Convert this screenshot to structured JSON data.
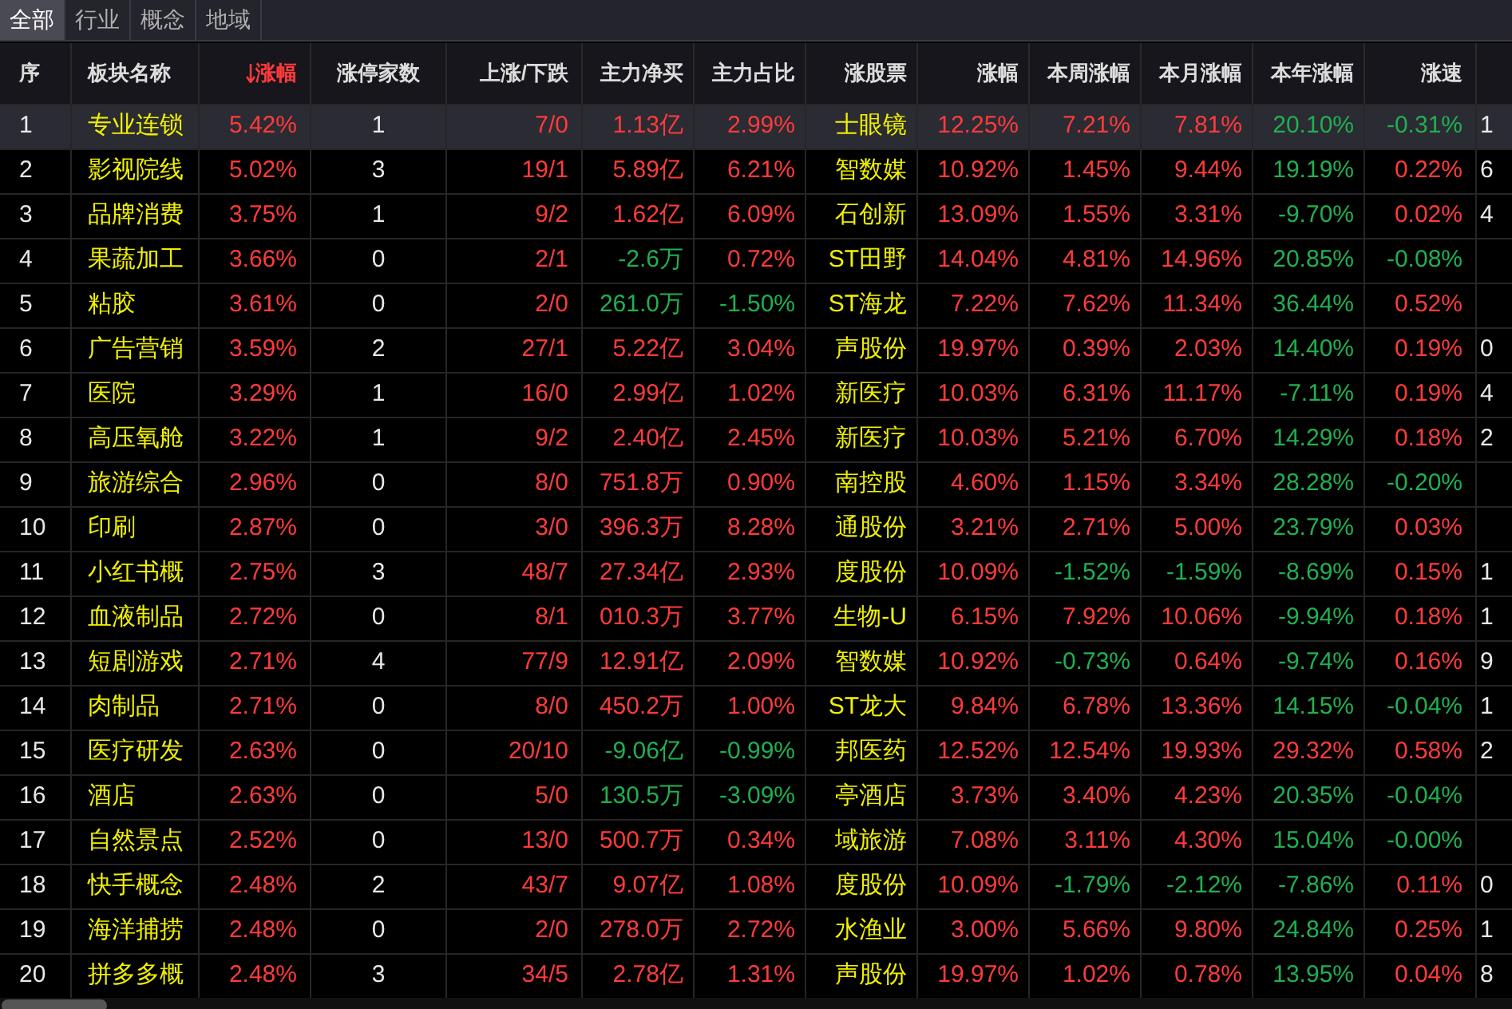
{
  "tabs": [
    {
      "label": "全部",
      "selected": true
    },
    {
      "label": "行业",
      "selected": false
    },
    {
      "label": "概念",
      "selected": false
    },
    {
      "label": "地域",
      "selected": false
    }
  ],
  "table": {
    "columns": [
      {
        "label": "序"
      },
      {
        "label": "板块名称"
      },
      {
        "label": "涨幅",
        "sorted_desc": true
      },
      {
        "label": "涨停家数"
      },
      {
        "label": "上涨/下跌"
      },
      {
        "label": "主力净买"
      },
      {
        "label": "主力占比"
      },
      {
        "label": "涨股票"
      },
      {
        "label": "涨幅"
      },
      {
        "label": "本周涨幅"
      },
      {
        "label": "本月涨幅"
      },
      {
        "label": "本年涨幅"
      },
      {
        "label": "涨速"
      }
    ],
    "rows": [
      {
        "selected": true,
        "cells": [
          "1",
          "专业连锁",
          {
            "text": "5.42%",
            "color": "#ff3b3b"
          },
          "1",
          {
            "text": "7/0",
            "color": "#ff3b3b"
          },
          {
            "text": "1.13亿",
            "color": "#ff3b3b"
          },
          {
            "text": "2.99%",
            "color": "#ff3b3b"
          },
          "士眼镜",
          {
            "text": "12.25%",
            "color": "#ff3b3b"
          },
          {
            "text": "7.21%",
            "color": "#ff3b3b"
          },
          {
            "text": "7.81%",
            "color": "#ff3b3b"
          },
          {
            "text": "20.10%",
            "color": "#20b050"
          },
          {
            "text": "-0.31%",
            "color": "#20b050"
          }
        ],
        "column_14": "1"
      },
      {
        "selected": false,
        "cells": [
          "2",
          "影视院线",
          {
            "text": "5.02%",
            "color": "#ff3b3b"
          },
          "3",
          {
            "text": "19/1",
            "color": "#ff3b3b"
          },
          {
            "text": "5.89亿",
            "color": "#ff3b3b"
          },
          {
            "text": "6.21%",
            "color": "#ff3b3b"
          },
          "智数媒",
          {
            "text": "10.92%",
            "color": "#ff3b3b"
          },
          {
            "text": "1.45%",
            "color": "#ff3b3b"
          },
          {
            "text": "9.44%",
            "color": "#ff3b3b"
          },
          {
            "text": "19.19%",
            "color": "#20b050"
          },
          {
            "text": "0.22%",
            "color": "#ff3b3b"
          }
        ],
        "column_14": "6"
      },
      {
        "selected": false,
        "cells": [
          "3",
          "品牌消费",
          {
            "text": "3.75%",
            "color": "#ff3b3b"
          },
          "1",
          {
            "text": "9/2",
            "color": "#ff3b3b"
          },
          {
            "text": "1.62亿",
            "color": "#ff3b3b"
          },
          {
            "text": "6.09%",
            "color": "#ff3b3b"
          },
          "石创新",
          {
            "text": "13.09%",
            "color": "#ff3b3b"
          },
          {
            "text": "1.55%",
            "color": "#ff3b3b"
          },
          {
            "text": "3.31%",
            "color": "#ff3b3b"
          },
          {
            "text": "-9.70%",
            "color": "#20b050"
          },
          {
            "text": "0.02%",
            "color": "#ff3b3b"
          }
        ],
        "column_14": "4"
      },
      {
        "selected": false,
        "cells": [
          "4",
          "果蔬加工",
          {
            "text": "3.66%",
            "color": "#ff3b3b"
          },
          "0",
          {
            "text": "2/1",
            "color": "#ff3b3b"
          },
          {
            "text": "-2.6万",
            "color": "#20b050"
          },
          {
            "text": "0.72%",
            "color": "#ff3b3b"
          },
          "ST田野",
          {
            "text": "14.04%",
            "color": "#ff3b3b"
          },
          {
            "text": "4.81%",
            "color": "#ff3b3b"
          },
          {
            "text": "14.96%",
            "color": "#ff3b3b"
          },
          {
            "text": "20.85%",
            "color": "#20b050"
          },
          {
            "text": "-0.08%",
            "color": "#20b050"
          }
        ]
      },
      {
        "selected": false,
        "cells": [
          "5",
          "粘胶",
          {
            "text": "3.61%",
            "color": "#ff3b3b"
          },
          "0",
          {
            "text": "2/0",
            "color": "#ff3b3b"
          },
          {
            "text": "261.0万",
            "color": "#20b050"
          },
          {
            "text": "-1.50%",
            "color": "#20b050"
          },
          "ST海龙",
          {
            "text": "7.22%",
            "color": "#ff3b3b"
          },
          {
            "text": "7.62%",
            "color": "#ff3b3b"
          },
          {
            "text": "11.34%",
            "color": "#ff3b3b"
          },
          {
            "text": "36.44%",
            "color": "#20b050"
          },
          {
            "text": "0.52%",
            "color": "#ff3b3b"
          }
        ]
      },
      {
        "selected": false,
        "cells": [
          "6",
          "广告营销",
          {
            "text": "3.59%",
            "color": "#ff3b3b"
          },
          "2",
          {
            "text": "27/1",
            "color": "#ff3b3b"
          },
          {
            "text": "5.22亿",
            "color": "#ff3b3b"
          },
          {
            "text": "3.04%",
            "color": "#ff3b3b"
          },
          "声股份",
          {
            "text": "19.97%",
            "color": "#ff3b3b"
          },
          {
            "text": "0.39%",
            "color": "#ff3b3b"
          },
          {
            "text": "2.03%",
            "color": "#ff3b3b"
          },
          {
            "text": "14.40%",
            "color": "#20b050"
          },
          {
            "text": "0.19%",
            "color": "#ff3b3b"
          }
        ],
        "column_14": "0"
      },
      {
        "selected": false,
        "cells": [
          "7",
          "医院",
          {
            "text": "3.29%",
            "color": "#ff3b3b"
          },
          "1",
          {
            "text": "16/0",
            "color": "#ff3b3b"
          },
          {
            "text": "2.99亿",
            "color": "#ff3b3b"
          },
          {
            "text": "1.02%",
            "color": "#ff3b3b"
          },
          "新医疗",
          {
            "text": "10.03%",
            "color": "#ff3b3b"
          },
          {
            "text": "6.31%",
            "color": "#ff3b3b"
          },
          {
            "text": "11.17%",
            "color": "#ff3b3b"
          },
          {
            "text": "-7.11%",
            "color": "#20b050"
          },
          {
            "text": "0.19%",
            "color": "#ff3b3b"
          }
        ],
        "column_14": "4"
      },
      {
        "selected": false,
        "cells": [
          "8",
          "高压氧舱",
          {
            "text": "3.22%",
            "color": "#ff3b3b"
          },
          "1",
          {
            "text": "9/2",
            "color": "#ff3b3b"
          },
          {
            "text": "2.40亿",
            "color": "#ff3b3b"
          },
          {
            "text": "2.45%",
            "color": "#ff3b3b"
          },
          "新医疗",
          {
            "text": "10.03%",
            "color": "#ff3b3b"
          },
          {
            "text": "5.21%",
            "color": "#ff3b3b"
          },
          {
            "text": "6.70%",
            "color": "#ff3b3b"
          },
          {
            "text": "14.29%",
            "color": "#20b050"
          },
          {
            "text": "0.18%",
            "color": "#ff3b3b"
          }
        ],
        "column_14": "2"
      },
      {
        "selected": false,
        "cells": [
          "9",
          "旅游综合",
          {
            "text": "2.96%",
            "color": "#ff3b3b"
          },
          "0",
          {
            "text": "8/0",
            "color": "#ff3b3b"
          },
          {
            "text": "751.8万",
            "color": "#ff3b3b"
          },
          {
            "text": "0.90%",
            "color": "#ff3b3b"
          },
          "南控股",
          {
            "text": "4.60%",
            "color": "#ff3b3b"
          },
          {
            "text": "1.15%",
            "color": "#ff3b3b"
          },
          {
            "text": "3.34%",
            "color": "#ff3b3b"
          },
          {
            "text": "28.28%",
            "color": "#20b050"
          },
          {
            "text": "-0.20%",
            "color": "#20b050"
          }
        ]
      },
      {
        "selected": false,
        "cells": [
          "10",
          "印刷",
          {
            "text": "2.87%",
            "color": "#ff3b3b"
          },
          "0",
          {
            "text": "3/0",
            "color": "#ff3b3b"
          },
          {
            "text": "396.3万",
            "color": "#ff3b3b"
          },
          {
            "text": "8.28%",
            "color": "#ff3b3b"
          },
          "通股份",
          {
            "text": "3.21%",
            "color": "#ff3b3b"
          },
          {
            "text": "2.71%",
            "color": "#ff3b3b"
          },
          {
            "text": "5.00%",
            "color": "#ff3b3b"
          },
          {
            "text": "23.79%",
            "color": "#20b050"
          },
          {
            "text": "0.03%",
            "color": "#ff3b3b"
          }
        ]
      },
      {
        "selected": false,
        "cells": [
          "11",
          "小红书概",
          {
            "text": "2.75%",
            "color": "#ff3b3b"
          },
          "3",
          {
            "text": "48/7",
            "color": "#ff3b3b"
          },
          {
            "text": "27.34亿",
            "color": "#ff3b3b"
          },
          {
            "text": "2.93%",
            "color": "#ff3b3b"
          },
          "度股份",
          {
            "text": "10.09%",
            "color": "#ff3b3b"
          },
          {
            "text": "-1.52%",
            "color": "#20b050"
          },
          {
            "text": "-1.59%",
            "color": "#20b050"
          },
          {
            "text": "-8.69%",
            "color": "#20b050"
          },
          {
            "text": "0.15%",
            "color": "#ff3b3b"
          }
        ],
        "column_14": "1"
      },
      {
        "selected": false,
        "cells": [
          "12",
          "血液制品",
          {
            "text": "2.72%",
            "color": "#ff3b3b"
          },
          "0",
          {
            "text": "8/1",
            "color": "#ff3b3b"
          },
          {
            "text": "010.3万",
            "color": "#ff3b3b"
          },
          {
            "text": "3.77%",
            "color": "#ff3b3b"
          },
          "生物-U",
          {
            "text": "6.15%",
            "color": "#ff3b3b"
          },
          {
            "text": "7.92%",
            "color": "#ff3b3b"
          },
          {
            "text": "10.06%",
            "color": "#ff3b3b"
          },
          {
            "text": "-9.94%",
            "color": "#20b050"
          },
          {
            "text": "0.18%",
            "color": "#ff3b3b"
          }
        ],
        "column_14": "1"
      },
      {
        "selected": false,
        "cells": [
          "13",
          "短剧游戏",
          {
            "text": "2.71%",
            "color": "#ff3b3b"
          },
          "4",
          {
            "text": "77/9",
            "color": "#ff3b3b"
          },
          {
            "text": "12.91亿",
            "color": "#ff3b3b"
          },
          {
            "text": "2.09%",
            "color": "#ff3b3b"
          },
          "智数媒",
          {
            "text": "10.92%",
            "color": "#ff3b3b"
          },
          {
            "text": "-0.73%",
            "color": "#20b050"
          },
          {
            "text": "0.64%",
            "color": "#ff3b3b"
          },
          {
            "text": "-9.74%",
            "color": "#20b050"
          },
          {
            "text": "0.16%",
            "color": "#ff3b3b"
          }
        ],
        "column_14": "9"
      },
      {
        "selected": false,
        "cells": [
          "14",
          "肉制品",
          {
            "text": "2.71%",
            "color": "#ff3b3b"
          },
          "0",
          {
            "text": "8/0",
            "color": "#ff3b3b"
          },
          {
            "text": "450.2万",
            "color": "#ff3b3b"
          },
          {
            "text": "1.00%",
            "color": "#ff3b3b"
          },
          "ST龙大",
          {
            "text": "9.84%",
            "color": "#ff3b3b"
          },
          {
            "text": "6.78%",
            "color": "#ff3b3b"
          },
          {
            "text": "13.36%",
            "color": "#ff3b3b"
          },
          {
            "text": "14.15%",
            "color": "#20b050"
          },
          {
            "text": "-0.04%",
            "color": "#20b050"
          }
        ],
        "column_14": "1"
      },
      {
        "selected": false,
        "cells": [
          "15",
          "医疗研发",
          {
            "text": "2.63%",
            "color": "#ff3b3b"
          },
          "0",
          {
            "text": "20/10",
            "color": "#ff3b3b"
          },
          {
            "text": "-9.06亿",
            "color": "#20b050"
          },
          {
            "text": "-0.99%",
            "color": "#20b050"
          },
          "邦医药",
          {
            "text": "12.52%",
            "color": "#ff3b3b"
          },
          {
            "text": "12.54%",
            "color": "#ff3b3b"
          },
          {
            "text": "19.93%",
            "color": "#ff3b3b"
          },
          {
            "text": "29.32%",
            "color": "#ff3b3b"
          },
          {
            "text": "0.58%",
            "color": "#ff3b3b"
          }
        ],
        "column_14": "2"
      },
      {
        "selected": false,
        "cells": [
          "16",
          "酒店",
          {
            "text": "2.63%",
            "color": "#ff3b3b"
          },
          "0",
          {
            "text": "5/0",
            "color": "#ff3b3b"
          },
          {
            "text": "130.5万",
            "color": "#20b050"
          },
          {
            "text": "-3.09%",
            "color": "#20b050"
          },
          "亭酒店",
          {
            "text": "3.73%",
            "color": "#ff3b3b"
          },
          {
            "text": "3.40%",
            "color": "#ff3b3b"
          },
          {
            "text": "4.23%",
            "color": "#ff3b3b"
          },
          {
            "text": "20.35%",
            "color": "#20b050"
          },
          {
            "text": "-0.04%",
            "color": "#20b050"
          }
        ]
      },
      {
        "selected": false,
        "cells": [
          "17",
          "自然景点",
          {
            "text": "2.52%",
            "color": "#ff3b3b"
          },
          "0",
          {
            "text": "13/0",
            "color": "#ff3b3b"
          },
          {
            "text": "500.7万",
            "color": "#ff3b3b"
          },
          {
            "text": "0.34%",
            "color": "#ff3b3b"
          },
          "域旅游",
          {
            "text": "7.08%",
            "color": "#ff3b3b"
          },
          {
            "text": "3.11%",
            "color": "#ff3b3b"
          },
          {
            "text": "4.30%",
            "color": "#ff3b3b"
          },
          {
            "text": "15.04%",
            "color": "#20b050"
          },
          {
            "text": "-0.00%",
            "color": "#20b050"
          }
        ]
      },
      {
        "selected": false,
        "cells": [
          "18",
          "快手概念",
          {
            "text": "2.48%",
            "color": "#ff3b3b"
          },
          "2",
          {
            "text": "43/7",
            "color": "#ff3b3b"
          },
          {
            "text": "9.07亿",
            "color": "#ff3b3b"
          },
          {
            "text": "1.08%",
            "color": "#ff3b3b"
          },
          "度股份",
          {
            "text": "10.09%",
            "color": "#ff3b3b"
          },
          {
            "text": "-1.79%",
            "color": "#20b050"
          },
          {
            "text": "-2.12%",
            "color": "#20b050"
          },
          {
            "text": "-7.86%",
            "color": "#20b050"
          },
          {
            "text": "0.11%",
            "color": "#ff3b3b"
          }
        ],
        "column_14": "0"
      },
      {
        "selected": false,
        "cells": [
          "19",
          "海洋捕捞",
          {
            "text": "2.48%",
            "color": "#ff3b3b"
          },
          "0",
          {
            "text": "2/0",
            "color": "#ff3b3b"
          },
          {
            "text": "278.0万",
            "color": "#ff3b3b"
          },
          {
            "text": "2.72%",
            "color": "#ff3b3b"
          },
          "水渔业",
          {
            "text": "3.00%",
            "color": "#ff3b3b"
          },
          {
            "text": "5.66%",
            "color": "#ff3b3b"
          },
          {
            "text": "9.80%",
            "color": "#ff3b3b"
          },
          {
            "text": "24.84%",
            "color": "#20b050"
          },
          {
            "text": "0.25%",
            "color": "#ff3b3b"
          }
        ],
        "column_14": "1"
      },
      {
        "selected": false,
        "cells": [
          "20",
          "拼多多概",
          {
            "text": "2.48%",
            "color": "#ff3b3b"
          },
          "3",
          {
            "text": "34/5",
            "color": "#ff3b3b"
          },
          {
            "text": "2.78亿",
            "color": "#ff3b3b"
          },
          {
            "text": "1.31%",
            "color": "#ff3b3b"
          },
          "声股份",
          {
            "text": "19.97%",
            "color": "#ff3b3b"
          },
          {
            "text": "1.02%",
            "color": "#ff3b3b"
          },
          {
            "text": "0.78%",
            "color": "#ff3b3b"
          },
          {
            "text": "13.95%",
            "color": "#20b050"
          },
          {
            "text": "0.04%",
            "color": "#ff3b3b"
          }
        ],
        "column_14": "8"
      }
    ]
  }
}
